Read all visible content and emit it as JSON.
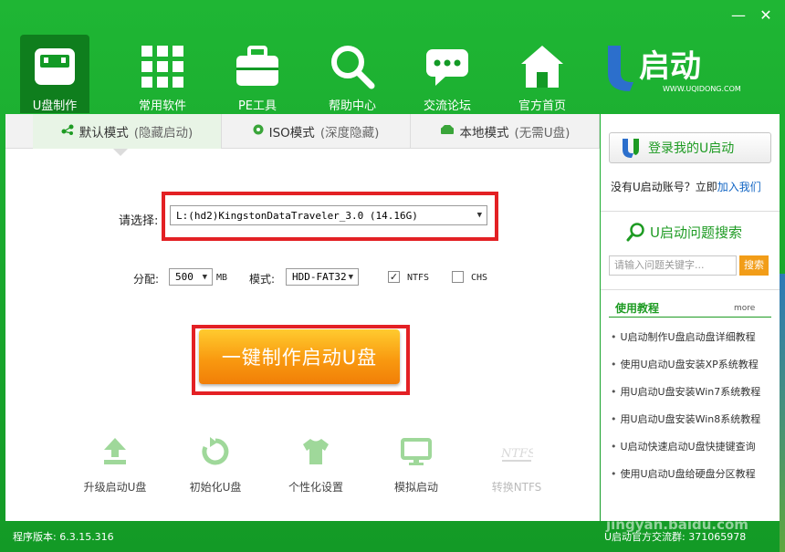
{
  "window": {
    "minimize": "—",
    "close": "✕"
  },
  "nav": [
    {
      "label": "U盘制作",
      "icon": "usb-drive-icon"
    },
    {
      "label": "常用软件",
      "icon": "apps-grid-icon"
    },
    {
      "label": "PE工具",
      "icon": "toolbox-icon"
    },
    {
      "label": "帮助中心",
      "icon": "search-icon"
    },
    {
      "label": "交流论坛",
      "icon": "chat-bubble-icon"
    },
    {
      "label": "官方首页",
      "icon": "home-icon"
    }
  ],
  "logo": {
    "mark": "U",
    "name": "启动",
    "url": "WWW.UQIDONG.COM"
  },
  "tabs": [
    {
      "label": "默认模式",
      "sub": "(隐藏启动)"
    },
    {
      "label": "ISO模式",
      "sub": "(深度隐藏)"
    },
    {
      "label": "本地模式",
      "sub": "(无需U盘)"
    }
  ],
  "form": {
    "select_label": "请选择:",
    "device": "L:(hd2)KingstonDataTraveler_3.0 (14.16G)",
    "alloc_label": "分配:",
    "alloc_value": "500",
    "alloc_unit": "MB",
    "mode_label": "模式:",
    "mode_value": "HDD-FAT32",
    "ntfs_label": "NTFS",
    "chs_label": "CHS",
    "ntfs_checked": true,
    "chs_checked": false
  },
  "primary_button": "一键制作启动U盘",
  "tools": [
    {
      "label": "升级启动U盘",
      "icon": "upgrade-arrow-icon"
    },
    {
      "label": "初始化U盘",
      "icon": "reset-icon"
    },
    {
      "label": "个性化设置",
      "icon": "tshirt-icon"
    },
    {
      "label": "模拟启动",
      "icon": "monitor-icon"
    },
    {
      "label": "转换NTFS",
      "icon": "ntfs-icon"
    }
  ],
  "side": {
    "login": "登录我的U启动",
    "account_text": "没有U启动账号？立即",
    "join_link": "加入我们",
    "search_title": "U启动问题搜索",
    "search_placeholder": "请输入问题关键字...",
    "search_button": "搜索",
    "tutorial_head": "使用教程",
    "more": "more",
    "tutorials": [
      "U启动制作U盘启动盘详细教程",
      "使用U启动U盘安装XP系统教程",
      "用U启动U盘安装Win7系统教程",
      "用U启动U盘安装Win8系统教程",
      "U启动快速启动U盘快捷键查询",
      "使用U启动U盘给硬盘分区教程"
    ]
  },
  "status": {
    "version": "程序版本: 6.3.15.316",
    "group": "U启动官方交流群: 371065978"
  },
  "watermark": {
    "brand": "Bai 经验",
    "url": "jingyan.baidu.com"
  },
  "colors": {
    "brand_green": "#1aa52a",
    "highlight_red": "#e32024",
    "button_orange": "#f99a10"
  }
}
